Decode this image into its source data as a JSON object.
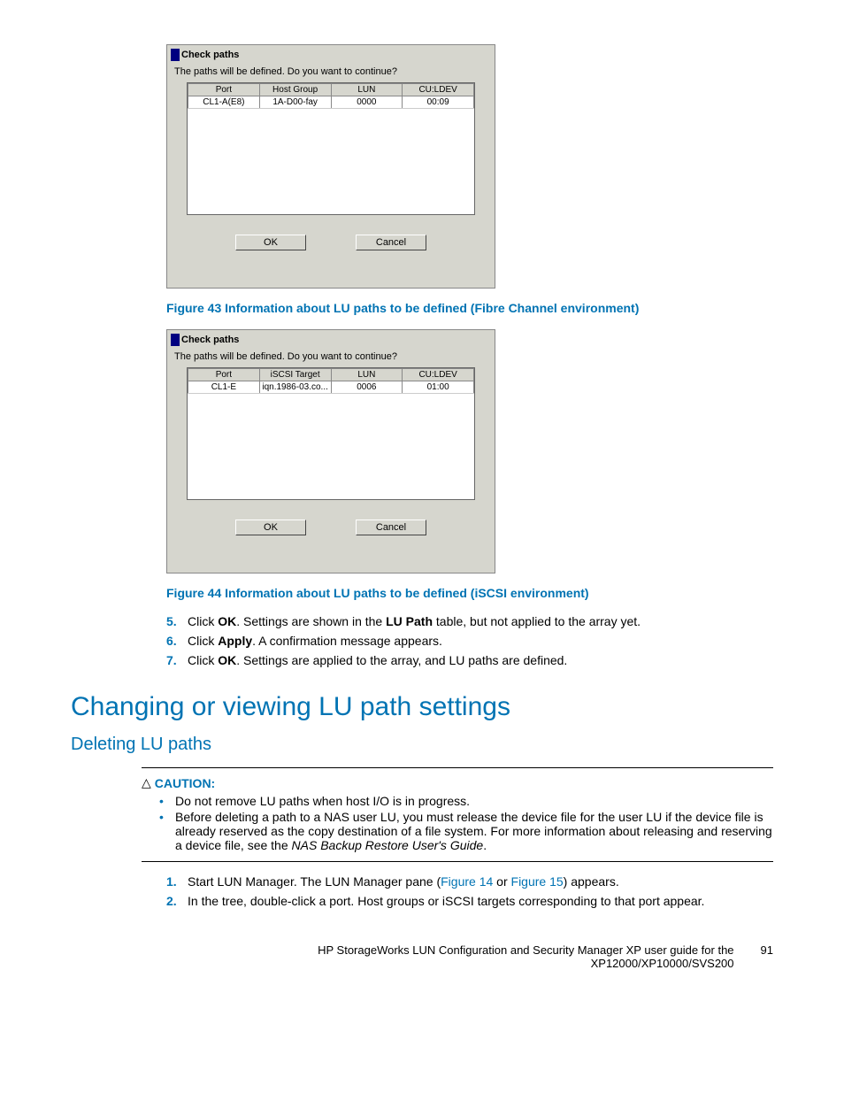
{
  "dialog1": {
    "title": "Check paths",
    "prompt": "The paths will be defined. Do you want to continue?",
    "headers": [
      "Port",
      "Host Group",
      "LUN",
      "CU:LDEV"
    ],
    "row": [
      "CL1-A(E8)",
      "1A-D00-fay",
      "0000",
      "00:09"
    ],
    "ok": "OK",
    "cancel": "Cancel"
  },
  "figure43": "Figure 43 Information about LU paths to be defined (Fibre Channel environment)",
  "dialog2": {
    "title": "Check paths",
    "prompt": "The paths will be defined. Do you want to continue?",
    "headers": [
      "Port",
      "iSCSI Target",
      "LUN",
      "CU:LDEV"
    ],
    "row": [
      "CL1-E",
      "iqn.1986-03.co...",
      "0006",
      "01:00"
    ],
    "ok": "OK",
    "cancel": "Cancel"
  },
  "figure44": "Figure 44 Information about LU paths to be defined (iSCSI environment)",
  "step5": {
    "num": "5.",
    "p1": "Click ",
    "b1": "OK",
    "p2": ". Settings are shown in the ",
    "b2": "LU Path",
    "p3": " table, but not applied to the array yet."
  },
  "step6": {
    "num": "6.",
    "p1": "Click ",
    "b1": "Apply",
    "p2": ". A confirmation message appears."
  },
  "step7": {
    "num": "7.",
    "p1": "Click ",
    "b1": "OK",
    "p2": ". Settings are applied to the array, and LU paths are defined."
  },
  "h1": "Changing or viewing LU path settings",
  "h2": "Deleting LU paths",
  "caution": {
    "head": "CAUTION:",
    "b1": "Do not remove LU paths when host I/O is in progress.",
    "b2a": "Before deleting a path to a NAS user LU, you must release the device file for the user LU if the device file is already reserved as the copy destination of a file system. For more information about releasing and reserving a device file, see the ",
    "b2b": "NAS Backup Restore User's Guide",
    "b2c": "."
  },
  "step1": {
    "num": "1.",
    "p1": "Start LUN Manager. The LUN Manager pane (",
    "link1": "Figure 14",
    "p2": " or ",
    "link2": "Figure 15",
    "p3": ") appears."
  },
  "step2": {
    "num": "2.",
    "p1": "In the tree, double-click a port. Host groups or iSCSI targets corresponding to that port appear."
  },
  "footer": {
    "line1": "HP StorageWorks LUN Configuration and Security Manager XP user guide for the",
    "line2": "XP12000/XP10000/SVS200",
    "page": "91"
  }
}
